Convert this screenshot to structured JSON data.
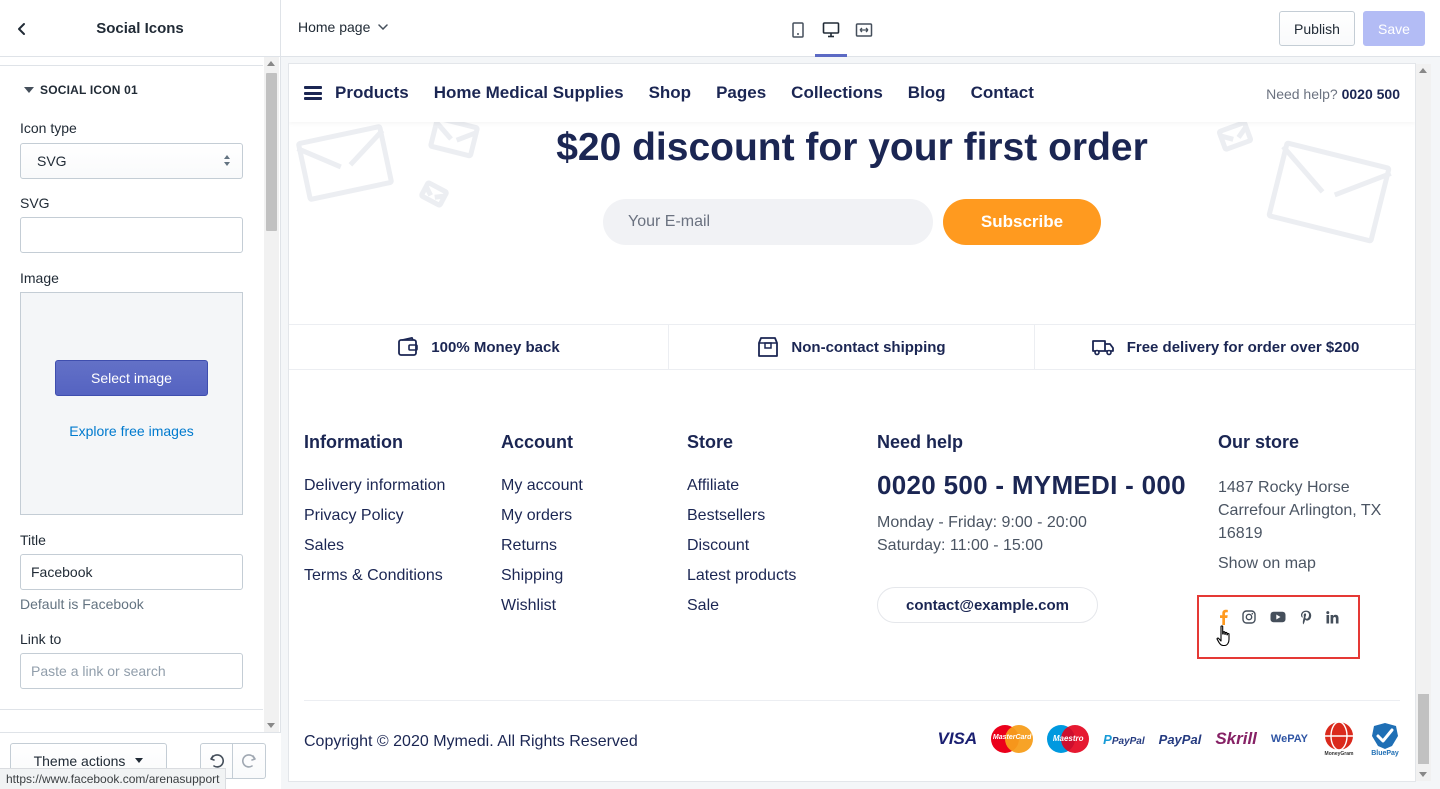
{
  "sidebar": {
    "title": "Social Icons",
    "section_title": "SOCIAL ICON 01",
    "icon_type_label": "Icon type",
    "icon_type_value": "SVG",
    "svg_label": "SVG",
    "svg_value": "",
    "image_label": "Image",
    "select_image_label": "Select image",
    "explore_label": "Explore free images",
    "title_label": "Title",
    "title_value": "Facebook",
    "title_help": "Default is Facebook",
    "link_label": "Link to",
    "link_placeholder": "Paste a link or search",
    "theme_actions_label": "Theme actions",
    "status_url": "https://www.facebook.com/arenasupport"
  },
  "topbar": {
    "page_select_label": "Home page",
    "publish_label": "Publish",
    "save_label": "Save"
  },
  "site": {
    "nav": {
      "items": [
        "Products",
        "Home Medical Supplies",
        "Shop",
        "Pages",
        "Collections",
        "Blog",
        "Contact"
      ],
      "help_prefix": "Need help?",
      "help_phone": "0020 500"
    },
    "newsletter": {
      "title": "$20 discount for your first order",
      "placeholder": "Your E-mail",
      "button": "Subscribe"
    },
    "features": [
      {
        "label": "100% Money back",
        "icon": "wallet-icon"
      },
      {
        "label": "Non-contact shipping",
        "icon": "box-icon"
      },
      {
        "label": "Free delivery for order over $200",
        "icon": "truck-icon"
      }
    ],
    "footer": {
      "information": {
        "title": "Information",
        "links": [
          "Delivery information",
          "Privacy Policy",
          "Sales",
          "Terms & Conditions"
        ]
      },
      "account": {
        "title": "Account",
        "links": [
          "My account",
          "My orders",
          "Returns",
          "Shipping",
          "Wishlist"
        ]
      },
      "store": {
        "title": "Store",
        "links": [
          "Affiliate",
          "Bestsellers",
          "Discount",
          "Latest products",
          "Sale"
        ]
      },
      "need_help": {
        "title": "Need help",
        "phone": "0020 500 - MYMEDI - 000",
        "hours_1": "Monday - Friday: 9:00 - 20:00",
        "hours_2": "Saturday: 11:00 - 15:00",
        "email": "contact@example.com"
      },
      "our_store": {
        "title": "Our store",
        "address_1": "1487 Rocky Horse",
        "address_2": "Carrefour Arlington, TX",
        "address_3": "16819",
        "show_map": "Show on map"
      },
      "social_icons": [
        "facebook-icon",
        "instagram-icon",
        "youtube-icon",
        "pinterest-icon",
        "linkedin-icon"
      ],
      "copyright": "Copyright © 2020 Mymedi. All Rights Reserved",
      "payments": {
        "visa": "VISA",
        "mastercard": "MasterCard",
        "maestro": "Maestro",
        "paypal_small": "PayPal",
        "paypal": "PayPal",
        "skrill": "Skrill",
        "wepay": "WePAY",
        "moneygram": "MoneyGram",
        "bluepay": "BluePay"
      }
    }
  },
  "colors": {
    "navy": "#1b2653",
    "orange": "#ff9a1f",
    "indigo": "#5c6ac4",
    "highlight_red": "#e53935"
  }
}
